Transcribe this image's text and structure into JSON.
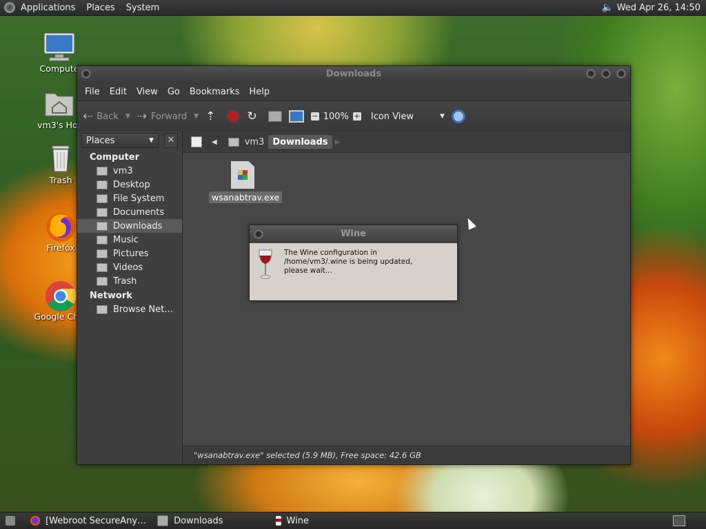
{
  "top_panel": {
    "menus": [
      "Applications",
      "Places",
      "System"
    ],
    "clock": "Wed Apr 26, 14:50"
  },
  "desktop_icons": [
    {
      "label": "Compute",
      "icon": "computer-icon"
    },
    {
      "label": "vm3's Hor",
      "icon": "home-folder-icon"
    },
    {
      "label": "Trash",
      "icon": "trash-icon"
    },
    {
      "label": "Firefox",
      "icon": "firefox-icon"
    },
    {
      "label": "Google Chro",
      "icon": "chrome-icon"
    }
  ],
  "window": {
    "title": "Downloads",
    "menubar": [
      "File",
      "Edit",
      "View",
      "Go",
      "Bookmarks",
      "Help"
    ],
    "toolbar": {
      "back": "Back",
      "forward": "Forward",
      "zoom": "100%",
      "view_mode": "Icon View"
    },
    "sidebar": {
      "selector": "Places",
      "close": "✕",
      "computer_header": "Computer",
      "computer_items": [
        "vm3",
        "Desktop",
        "File System",
        "Documents",
        "Downloads",
        "Music",
        "Pictures",
        "Videos",
        "Trash"
      ],
      "selected": "Downloads",
      "network_header": "Network",
      "network_items": [
        "Browse Net…"
      ]
    },
    "pathbar": {
      "crumbs": [
        "vm3",
        "Downloads"
      ]
    },
    "files": [
      {
        "name": "wsanabtrav.exe"
      }
    ],
    "status": "\"wsanabtrav.exe\" selected (5.9 MB), Free space: 42.6 GB"
  },
  "dialog": {
    "title": "Wine",
    "message": "The Wine configuration in /home/vm3/.wine is being updated, please wait..."
  },
  "taskbar": {
    "tasks": [
      "[Webroot SecureAny…",
      "Downloads",
      "Wine"
    ]
  },
  "colors": {
    "panel": "#2f2f2f",
    "window_bg": "#3b3b3b",
    "content_bg": "#474747",
    "dialog_bg": "#d6d2cb",
    "selection": "#5a5a5a"
  }
}
